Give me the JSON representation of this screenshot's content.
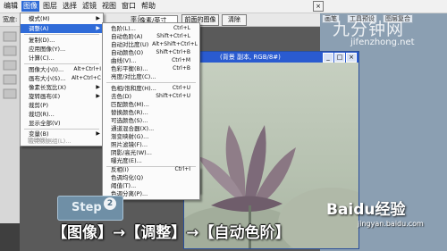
{
  "menubar": {
    "items": [
      {
        "label": "编辑"
      },
      {
        "label": "图像"
      },
      {
        "label": "图层"
      },
      {
        "label": "选择"
      },
      {
        "label": "滤镜"
      },
      {
        "label": "视图"
      },
      {
        "label": "窗口"
      },
      {
        "label": "帮助"
      }
    ],
    "active_index": 1
  },
  "options_bar": {
    "width_label": "宽度:",
    "resolution_label": "率:",
    "resolution_unit": "像素/英寸",
    "front_image_button": "前面的图像",
    "clear_button": "清除"
  },
  "right_panel": {
    "tab1": "画笔",
    "tab2": "工具预设",
    "tab3": "图层复合"
  },
  "watermark": {
    "site_cn": "九分钟网",
    "site_url": "jifenzhong.net"
  },
  "document": {
    "title": "(背景 副本, RGB/8#)",
    "min_label": "_",
    "max_label": "□",
    "close_label": "×"
  },
  "image_menu": {
    "items": [
      {
        "label": "模式(M)",
        "arrow": "▶"
      },
      {
        "label": "调整(A)",
        "arrow": "▶"
      },
      {
        "label": "复制(D)..."
      },
      {
        "label": "应用图像(Y)..."
      },
      {
        "label": "计算(C)..."
      },
      {
        "label": "图像大小(I)...",
        "shortcut": "Alt+Ctrl+I"
      },
      {
        "label": "画布大小(S)...",
        "shortcut": "Alt+Ctrl+C"
      },
      {
        "label": "像素长宽比(X)",
        "arrow": "▶"
      },
      {
        "label": "旋转画布(E)",
        "arrow": "▶"
      },
      {
        "label": "裁剪(P)"
      },
      {
        "label": "裁切(R)..."
      },
      {
        "label": "显示全部(V)"
      },
      {
        "label": "变量(B)",
        "arrow": "▶"
      },
      {
        "label": "应用数据组(L)..."
      },
      {
        "label": "陷印(T)..."
      }
    ]
  },
  "adjust_menu": {
    "items": [
      {
        "label": "色阶(L)...",
        "shortcut": "Ctrl+L"
      },
      {
        "label": "自动色阶(A)",
        "shortcut": "Shift+Ctrl+L"
      },
      {
        "label": "自动对比度(U)",
        "shortcut": "Alt+Shift+Ctrl+L"
      },
      {
        "label": "自动颜色(O)",
        "shortcut": "Shift+Ctrl+B"
      },
      {
        "label": "曲线(V)...",
        "shortcut": "Ctrl+M"
      },
      {
        "label": "色彩平衡(B)...",
        "shortcut": "Ctrl+B"
      },
      {
        "label": "亮度/对比度(C)..."
      },
      {
        "label": "色相/饱和度(H)...",
        "shortcut": "Ctrl+U"
      },
      {
        "label": "去色(D)",
        "shortcut": "Shift+Ctrl+U"
      },
      {
        "label": "匹配颜色(M)..."
      },
      {
        "label": "替换颜色(R)..."
      },
      {
        "label": "可选颜色(S)..."
      },
      {
        "label": "通道混合器(X)..."
      },
      {
        "label": "渐变映射(G)..."
      },
      {
        "label": "照片滤镜(F)..."
      },
      {
        "label": "阴影/高光(W)..."
      },
      {
        "label": "曝光度(E)..."
      },
      {
        "label": "反相(I)",
        "shortcut": "Ctrl+I"
      },
      {
        "label": "色调均化(Q)"
      },
      {
        "label": "阈值(T)..."
      },
      {
        "label": "色调分离(P)..."
      }
    ]
  },
  "step": {
    "label": "Step",
    "number": "2"
  },
  "caption": "【图像】→【调整】→【自动色阶】",
  "baidu": {
    "logo": "Baidu经验",
    "url": "jingyan.baidu.com"
  },
  "colors": {
    "highlight": "#2f6bd8",
    "titlebar": "#2a5bd0"
  }
}
